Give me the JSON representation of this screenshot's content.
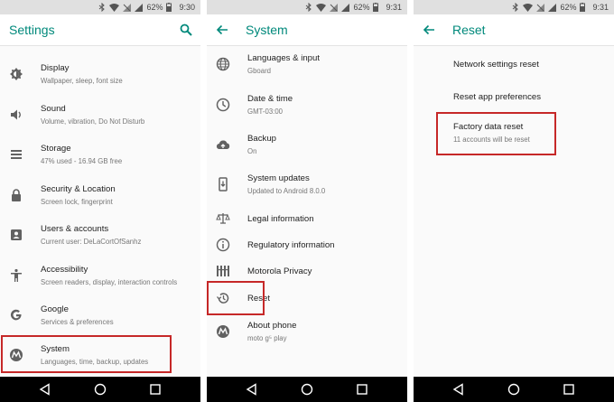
{
  "status_bar": [
    {
      "battery": "62%",
      "time": "9:30"
    },
    {
      "battery": "62%",
      "time": "9:31"
    },
    {
      "battery": "62%",
      "time": "9:31"
    }
  ],
  "settings": {
    "title": "Settings",
    "items": [
      {
        "title": "Display",
        "subtitle": "Wallpaper, sleep, font size",
        "icon": "brightness-icon"
      },
      {
        "title": "Sound",
        "subtitle": "Volume, vibration, Do Not Disturb",
        "icon": "volume-icon"
      },
      {
        "title": "Storage",
        "subtitle": "47% used - 16.94 GB free",
        "icon": "storage-icon"
      },
      {
        "title": "Security & Location",
        "subtitle": "Screen lock, fingerprint",
        "icon": "lock-icon"
      },
      {
        "title": "Users & accounts",
        "subtitle": "Current user: DeLaCortOfSanhz",
        "icon": "account-icon"
      },
      {
        "title": "Accessibility",
        "subtitle": "Screen readers, display, interaction controls",
        "icon": "accessibility-icon"
      },
      {
        "title": "Google",
        "subtitle": "Services & preferences",
        "icon": "google-icon"
      },
      {
        "title": "System",
        "subtitle": "Languages, time, backup, updates",
        "icon": "motorola-icon"
      }
    ]
  },
  "system": {
    "title": "System",
    "items": [
      {
        "title": "Languages & input",
        "subtitle": "Gboard",
        "icon": "globe-icon"
      },
      {
        "title": "Date & time",
        "subtitle": "GMT-03:00",
        "icon": "clock-icon"
      },
      {
        "title": "Backup",
        "subtitle": "On",
        "icon": "cloud-upload-icon"
      },
      {
        "title": "System updates",
        "subtitle": "Updated to Android 8.0.0",
        "icon": "phone-update-icon"
      },
      {
        "title": "Legal information",
        "subtitle": "",
        "icon": "scale-icon"
      },
      {
        "title": "Regulatory information",
        "subtitle": "",
        "icon": "info-icon"
      },
      {
        "title": "Motorola Privacy",
        "subtitle": "",
        "icon": "privacy-icon"
      },
      {
        "title": "Reset",
        "subtitle": "",
        "icon": "restore-icon"
      },
      {
        "title": "About phone",
        "subtitle": "moto g⁵ play",
        "icon": "motorola-icon"
      }
    ]
  },
  "reset": {
    "title": "Reset",
    "items": [
      {
        "title": "Network settings reset",
        "subtitle": ""
      },
      {
        "title": "Reset app preferences",
        "subtitle": ""
      },
      {
        "title": "Factory data reset",
        "subtitle": "11 accounts will be reset"
      }
    ]
  },
  "colors": {
    "accent": "#00897b",
    "highlight": "#c62828",
    "navbar": "#000000",
    "statusbar": "#e0e0e0"
  }
}
